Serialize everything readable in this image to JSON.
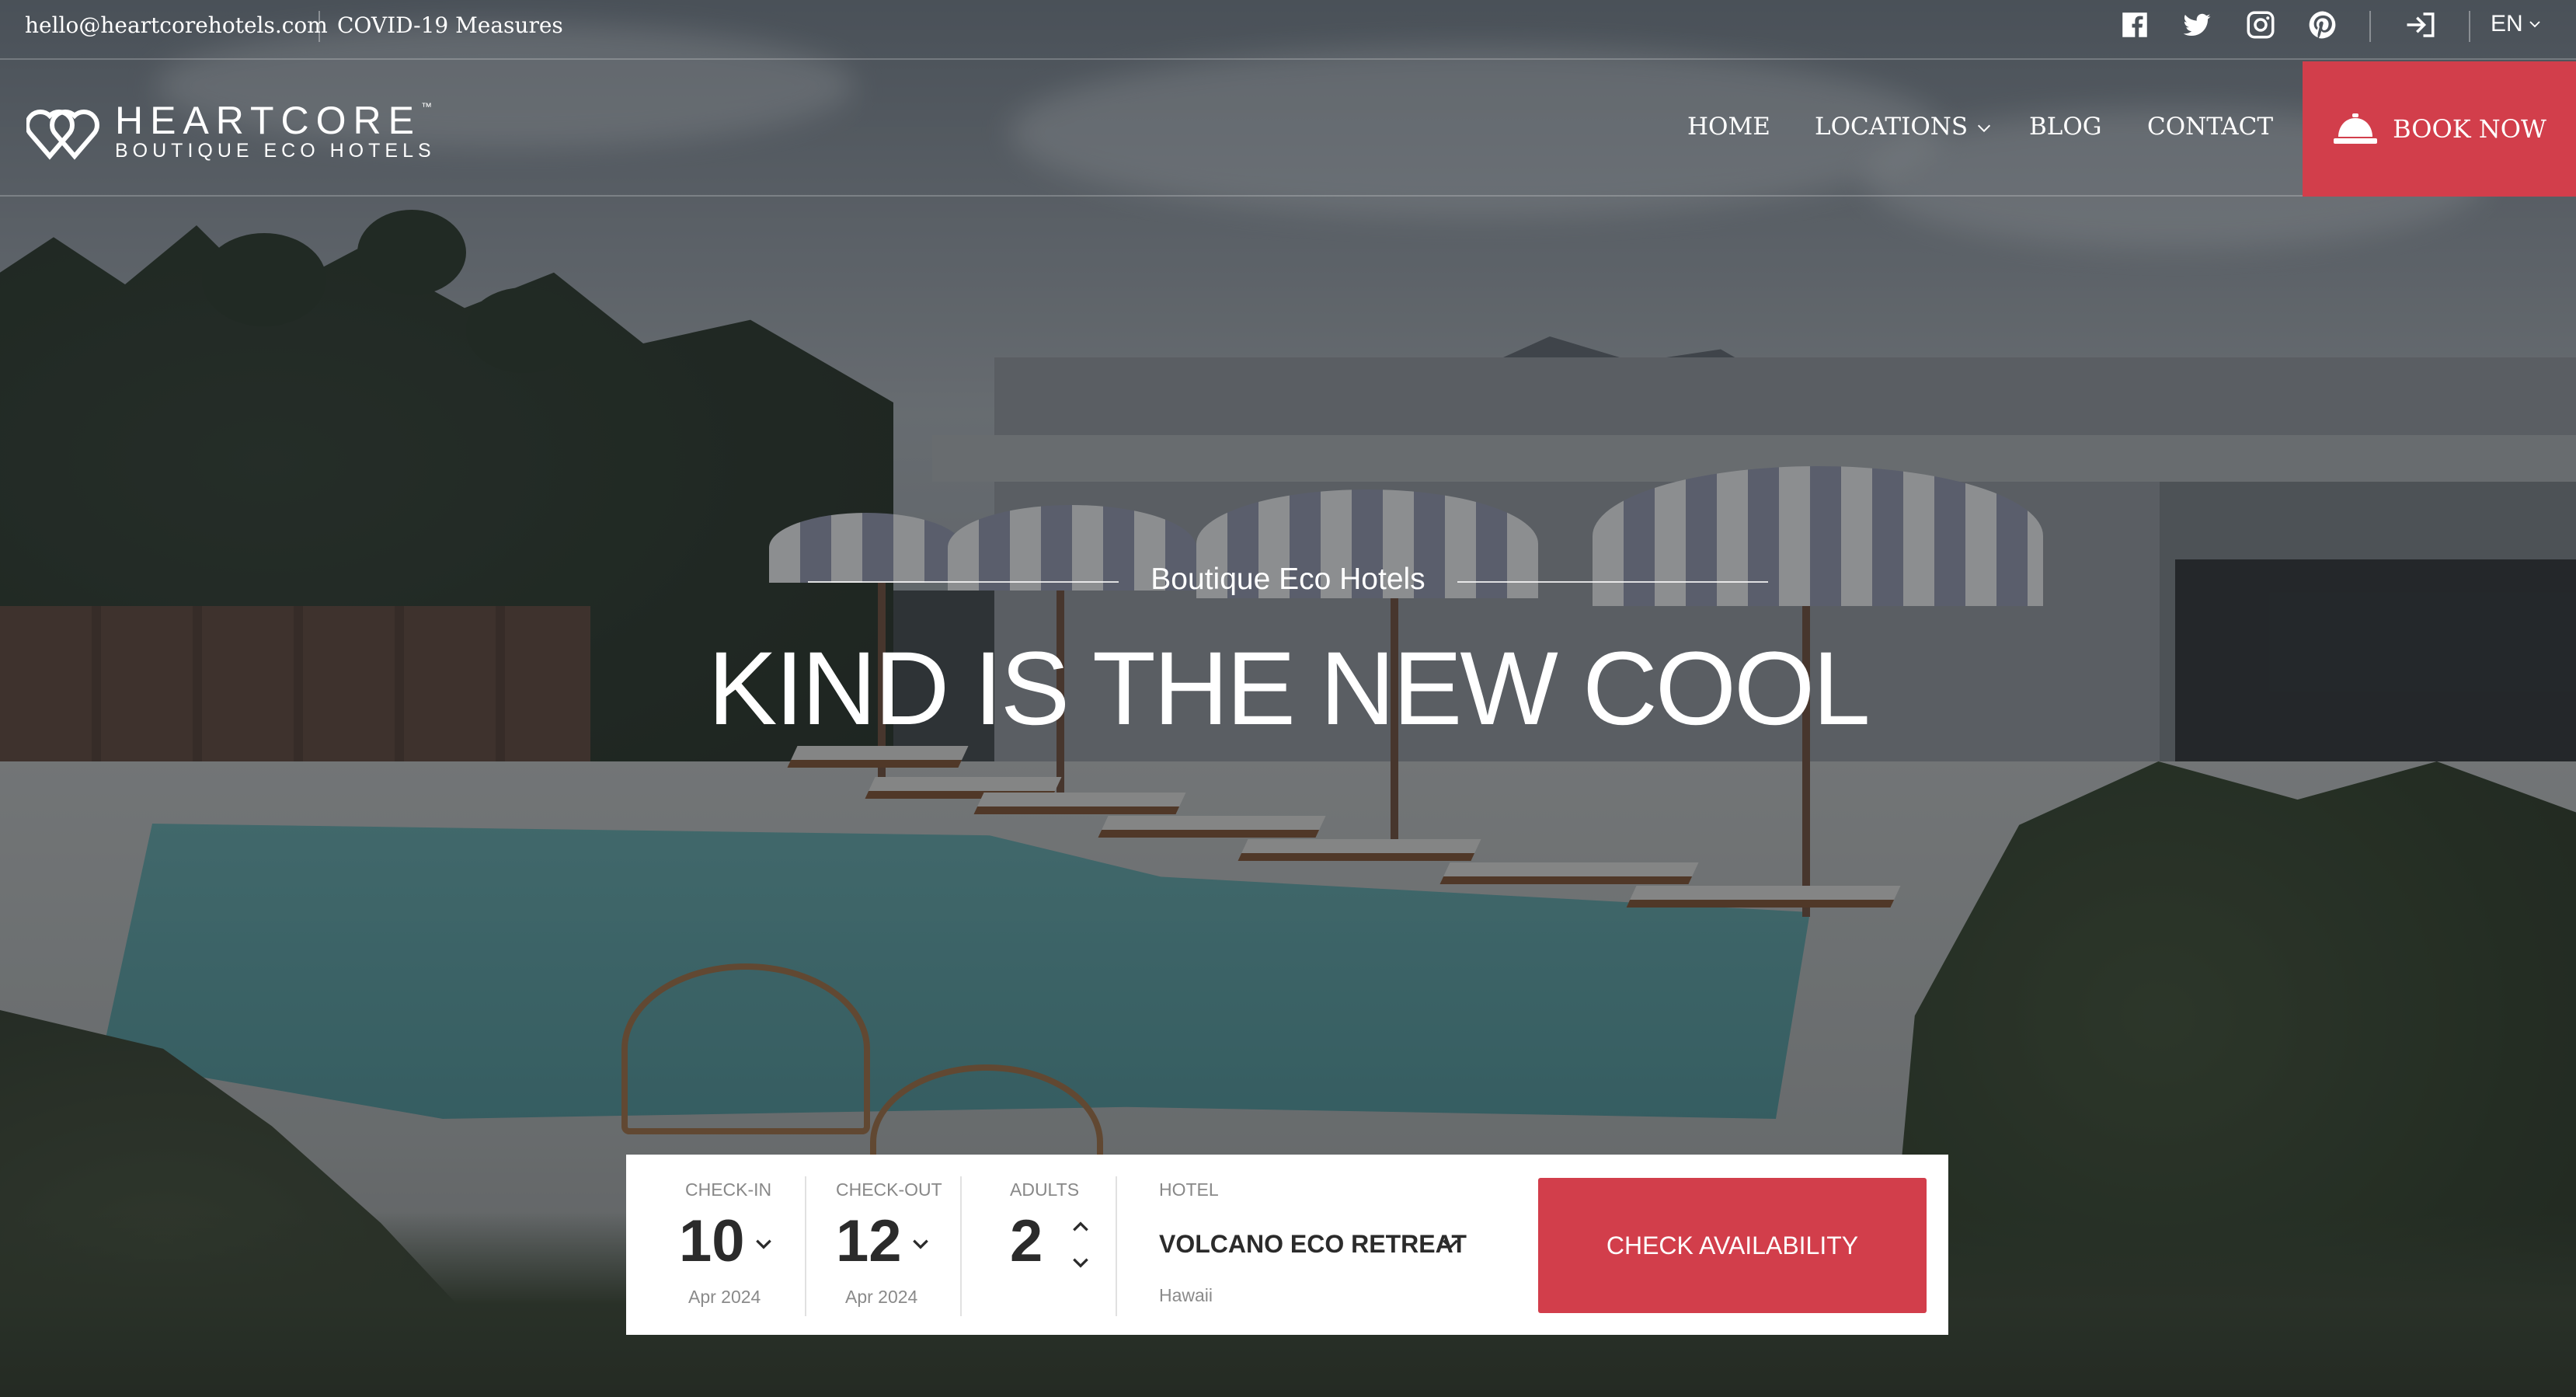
{
  "topbar": {
    "email": "hello@heartcorehotels.com",
    "covid_link": "COVID-19 Measures",
    "social_icons": [
      "facebook-icon",
      "twitter-icon",
      "instagram-icon",
      "pinterest-icon"
    ],
    "login_icon": "login-icon",
    "language": "EN"
  },
  "brand": {
    "name": "HEARTCORE",
    "trademark": "™",
    "tagline": "BOUTIQUE ECO HOTELS"
  },
  "nav": {
    "items": [
      {
        "label": "HOME"
      },
      {
        "label": "LOCATIONS",
        "has_dropdown": true
      },
      {
        "label": "BLOG"
      },
      {
        "label": "CONTACT"
      }
    ],
    "book_now": "BOOK NOW",
    "book_icon": "service-bell-icon"
  },
  "hero": {
    "subtitle": "Boutique Eco Hotels",
    "headline": "KIND IS THE NEW COOL"
  },
  "booking": {
    "checkin": {
      "label": "CHECK-IN",
      "day": "10",
      "month": "Apr 2024"
    },
    "checkout": {
      "label": "CHECK-OUT",
      "day": "12",
      "month": "Apr 2024"
    },
    "adults": {
      "label": "ADULTS",
      "value": "2"
    },
    "hotel": {
      "label": "HOTEL",
      "value": "VOLCANO ECO RETREAT",
      "location": "Hawaii"
    },
    "button": "CHECK AVAILABILITY"
  },
  "colors": {
    "accent": "#d23e4b",
    "widget_bg": "#ffffff",
    "text_dark": "#2b2b2b"
  }
}
